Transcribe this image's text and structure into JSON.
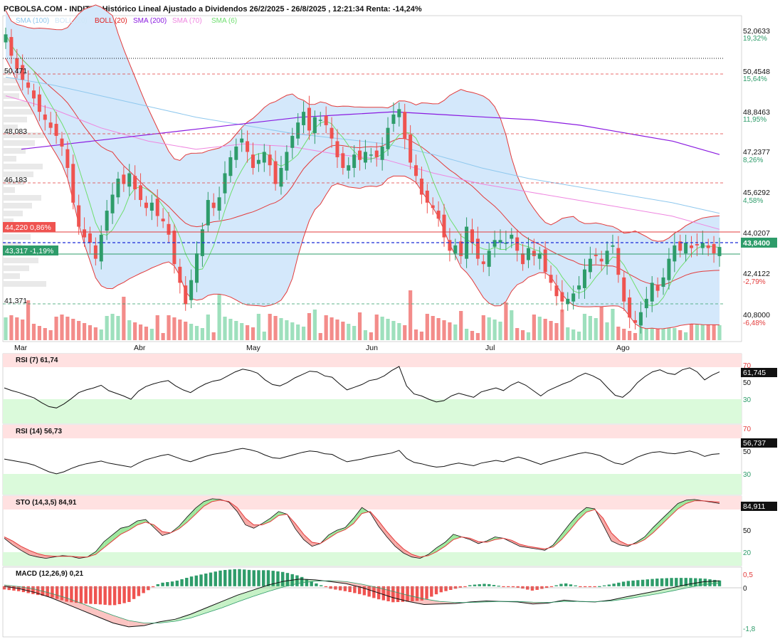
{
  "header": {
    "title": "PCBOLSA.COM - INDITEX Histórico Lineal Ajustado a Dividendos 26/2/2025 - 26/8/2025 , 12:21:34 Renta: -14,24%"
  },
  "legend": [
    {
      "label": "SMA (100)",
      "color": "#8fc8ee"
    },
    {
      "label": "BOLL (20)",
      "color": "#cfe7f8"
    },
    {
      "label": "BOLL (20)",
      "color": "#e02020"
    },
    {
      "label": "SMA (200)",
      "color": "#8a1ae0"
    },
    {
      "label": "SMA (70)",
      "color": "#ef86e0"
    },
    {
      "label": "SMA (6)",
      "color": "#6fde6f"
    }
  ],
  "colors": {
    "up": "#2e9c6a",
    "down": "#ef5350",
    "vol_up": "#9ee0bd",
    "vol_down": "#f38c8a",
    "band_fill": "#d4e8fb",
    "boll": "#e33b3b",
    "sma100": "#8fc8ee",
    "sma200": "#8a1ae0",
    "sma70": "#ef86e0",
    "sma6": "#6fde6f"
  },
  "y_axis": {
    "prices": [
      "52,0633",
      "50,4548",
      "48,8463",
      "47,2377",
      "45,6292",
      "44,0207",
      "42,4122",
      "40,8000"
    ],
    "pcts": [
      "19,32%",
      "15,64%",
      "11,95%",
      "8,26%",
      "4,58%",
      "",
      "-2,79%",
      "-6,48%"
    ],
    "current": "43,8400"
  },
  "levels": [
    "50,471",
    "48,083",
    "46,183",
    "41,371"
  ],
  "price_tags": {
    "upper": "44,220  0,86%",
    "lower": "43,317  -1,19%"
  },
  "x_axis": [
    "Mar",
    "Abr",
    "May",
    "Jun",
    "Jul",
    "Ago"
  ],
  "panels": {
    "rsi7": {
      "label": "RSI (7)   61,74",
      "levels": [
        "70",
        "50",
        "30"
      ],
      "value": "61,745"
    },
    "rsi14": {
      "label": "RSI (14)   56,73",
      "levels": [
        "70",
        "50",
        "30"
      ],
      "value": "56,737"
    },
    "sto": {
      "label": "STO (14,3,5)   84,91",
      "levels": [
        "80",
        "50",
        "20"
      ],
      "value": "84,911"
    },
    "macd": {
      "label": "MACD (12,26,9)   0,21",
      "levels": [
        "0,5",
        "0",
        "-1,8"
      ]
    }
  },
  "chart_data": [
    {
      "type": "candlestick",
      "title": "INDITEX Histórico Lineal Ajustado a Dividendos 26/2/2025 - 26/8/2025",
      "x_range": [
        "26/2/2025",
        "26/8/2025"
      ],
      "ylim": [
        40.3,
        52.5
      ],
      "x_ticks": [
        "Mar",
        "Abr",
        "May",
        "Jun",
        "Jul",
        "Ago"
      ],
      "closes": [
        51.8,
        51.0,
        50.5,
        50.1,
        49.8,
        49.4,
        48.9,
        48.6,
        48.3,
        48.0,
        47.6,
        46.8,
        45.5,
        44.6,
        44.2,
        44.0,
        43.4,
        44.3,
        45.2,
        45.8,
        46.4,
        46.2,
        46.6,
        46.0,
        45.6,
        45.3,
        45.5,
        45.0,
        44.8,
        44.3,
        43.2,
        42.5,
        41.7,
        42.6,
        43.6,
        44.5,
        45.6,
        45.3,
        45.7,
        46.6,
        47.2,
        47.6,
        47.9,
        47.4,
        46.8,
        47.1,
        47.4,
        46.9,
        46.2,
        46.8,
        47.4,
        48.0,
        48.5,
        48.9,
        48.2,
        48.7,
        48.6,
        48.4,
        47.9,
        47.2,
        46.8,
        46.9,
        47.3,
        47.1,
        47.4,
        47.3,
        47.2,
        47.6,
        48.3,
        48.8,
        49.0,
        47.9,
        47.0,
        46.5,
        45.8,
        45.5,
        45.3,
        44.9,
        44.2,
        43.7,
        43.9,
        43.5,
        44.6,
        44.0,
        43.4,
        43.2,
        43.7,
        44.1,
        44.1,
        44.0,
        44.3,
        43.7,
        43.2,
        43.8,
        43.5,
        43.6,
        42.9,
        42.5,
        42.0,
        41.8,
        41.9,
        42.1,
        42.4,
        43.0,
        43.4,
        43.5,
        43.3,
        43.7,
        43.9,
        42.8,
        41.8,
        41.2,
        41.0,
        41.4,
        41.9,
        42.5,
        42.2,
        42.7,
        43.4,
        43.9,
        43.7,
        44.0,
        43.8,
        43.9,
        44.0,
        43.8,
        43.6,
        43.84
      ],
      "series": [
        {
          "name": "SMA (100)",
          "values": [
            50.2,
            49.9,
            49.5,
            49.1,
            48.7,
            48.4,
            48.1,
            47.9,
            47.7,
            47.3,
            46.8,
            46.4,
            46.1,
            45.8,
            45.5,
            45.1
          ]
        },
        {
          "name": "SMA (200)",
          "values": [
            47.5,
            47.7,
            47.9,
            48.1,
            48.3,
            48.5,
            48.7,
            48.8,
            48.9,
            48.8,
            48.7,
            48.6,
            48.4,
            48.1,
            47.8,
            47.3
          ]
        },
        {
          "name": "SMA (70)",
          "values": [
            49.5,
            49.0,
            48.3,
            47.8,
            47.5,
            47.7,
            47.6,
            47.3,
            47.1,
            46.6,
            46.2,
            45.9,
            45.6,
            45.3,
            45.0,
            44.5
          ]
        }
      ]
    },
    {
      "type": "line",
      "title": "RSI (7)",
      "ylim": [
        0,
        100
      ],
      "guides": [
        70,
        50,
        30
      ],
      "values": [
        52,
        48,
        45,
        41,
        37,
        30,
        24,
        22,
        28,
        36,
        45,
        49,
        52,
        56,
        48,
        44,
        40,
        35,
        47,
        54,
        58,
        61,
        63,
        55,
        49,
        45,
        52,
        58,
        62,
        64,
        70,
        76,
        80,
        78,
        74,
        64,
        57,
        55,
        60,
        67,
        72,
        77,
        76,
        70,
        68,
        58,
        49,
        53,
        57,
        63,
        65,
        70,
        78,
        84,
        55,
        43,
        40,
        35,
        31,
        33,
        40,
        44,
        41,
        38,
        46,
        49,
        52,
        48,
        56,
        61,
        56,
        48,
        40,
        48,
        53,
        58,
        62,
        69,
        74,
        70,
        64,
        52,
        41,
        38,
        47,
        60,
        69,
        76,
        79,
        74,
        72,
        79,
        82,
        76,
        64,
        71,
        76
      ],
      "last": 61.745
    },
    {
      "type": "line",
      "title": "RSI (14)",
      "ylim": [
        0,
        100
      ],
      "guides": [
        70,
        50,
        30
      ],
      "values": [
        52,
        50,
        48,
        46,
        43,
        38,
        33,
        30,
        33,
        38,
        42,
        45,
        47,
        49,
        46,
        44,
        42,
        40,
        46,
        51,
        54,
        57,
        59,
        55,
        51,
        48,
        52,
        56,
        59,
        61,
        63,
        66,
        68,
        66,
        63,
        58,
        54,
        53,
        56,
        59,
        62,
        64,
        63,
        60,
        59,
        53,
        48,
        50,
        52,
        55,
        57,
        59,
        61,
        65,
        53,
        47,
        45,
        42,
        40,
        41,
        44,
        46,
        44,
        42,
        46,
        48,
        50,
        48,
        52,
        55,
        52,
        48,
        44,
        48,
        51,
        54,
        57,
        60,
        62,
        60,
        57,
        51,
        46,
        44,
        49,
        55,
        59,
        62,
        63,
        61,
        60,
        62,
        64,
        61,
        56,
        59,
        60
      ],
      "last": 56.737
    },
    {
      "type": "line",
      "title": "STO (14,3,5)",
      "ylim": [
        0,
        100
      ],
      "guides": [
        80,
        50,
        20
      ],
      "series": [
        {
          "name": "%K",
          "values": [
            40,
            30,
            22,
            15,
            12,
            10,
            12,
            14,
            13,
            10,
            12,
            20,
            35,
            45,
            55,
            58,
            66,
            68,
            56,
            44,
            48,
            58,
            72,
            85,
            95,
            99,
            98,
            94,
            80,
            60,
            55,
            62,
            70,
            80,
            76,
            54,
            38,
            28,
            32,
            45,
            52,
            56,
            70,
            86,
            78,
            58,
            42,
            28,
            18,
            12,
            10,
            16,
            26,
            34,
            46,
            42,
            38,
            32,
            36,
            42,
            40,
            34,
            28,
            26,
            24,
            22,
            30,
            46,
            62,
            76,
            86,
            84,
            60,
            36,
            30,
            28,
            34,
            42,
            56,
            68,
            80,
            92,
            97,
            98,
            96,
            94,
            92
          ],
          "colored": "green where %K above %D, red where below"
        },
        {
          "name": "%D",
          "values": [
            42,
            36,
            28,
            22,
            17,
            14,
            13,
            13,
            13,
            12,
            12,
            16,
            26,
            36,
            46,
            52,
            60,
            64,
            60,
            50,
            48,
            54,
            64,
            76,
            88,
            95,
            97,
            95,
            86,
            70,
            60,
            60,
            65,
            74,
            76,
            62,
            46,
            34,
            32,
            40,
            48,
            53,
            62,
            77,
            80,
            66,
            50,
            36,
            24,
            16,
            12,
            14,
            20,
            28,
            38,
            42,
            40,
            35,
            34,
            38,
            40,
            37,
            31,
            28,
            26,
            24,
            27,
            38,
            52,
            67,
            79,
            83,
            70,
            48,
            36,
            30,
            32,
            38,
            48,
            60,
            72,
            84,
            92,
            96,
            96,
            95,
            94
          ]
        }
      ],
      "last": 84.911
    },
    {
      "type": "line",
      "title": "MACD (12,26,9)",
      "ylim": [
        -1.8,
        0.5
      ],
      "series": [
        {
          "name": "MACD",
          "values": [
            0,
            -0.1,
            -0.25,
            -0.45,
            -0.7,
            -0.95,
            -1.2,
            -1.45,
            -1.6,
            -1.55,
            -1.4,
            -1.3,
            -1.1,
            -0.85,
            -0.6,
            -0.35,
            -0.15,
            0.05,
            0.2,
            0.28,
            0.25,
            0.18,
            0.1,
            -0.05,
            -0.25,
            -0.45,
            -0.6,
            -0.72,
            -0.7,
            -0.68,
            -0.62,
            -0.58,
            -0.6,
            -0.62,
            -0.7,
            -0.66,
            -0.55,
            -0.6,
            -0.62,
            -0.55,
            -0.42,
            -0.3,
            -0.18,
            -0.05,
            0.08,
            0.18,
            0.21
          ]
        },
        {
          "name": "Signal",
          "values": [
            0.05,
            -0.02,
            -0.12,
            -0.28,
            -0.46,
            -0.68,
            -0.92,
            -1.15,
            -1.35,
            -1.45,
            -1.45,
            -1.38,
            -1.25,
            -1.05,
            -0.85,
            -0.62,
            -0.4,
            -0.2,
            -0.02,
            0.12,
            0.2,
            0.22,
            0.18,
            0.08,
            -0.05,
            -0.2,
            -0.36,
            -0.5,
            -0.6,
            -0.64,
            -0.64,
            -0.62,
            -0.6,
            -0.6,
            -0.63,
            -0.64,
            -0.6,
            -0.6,
            -0.61,
            -0.58,
            -0.5,
            -0.4,
            -0.3,
            -0.18,
            -0.05,
            0.06,
            0.12
          ]
        }
      ],
      "last": 0.21
    }
  ]
}
